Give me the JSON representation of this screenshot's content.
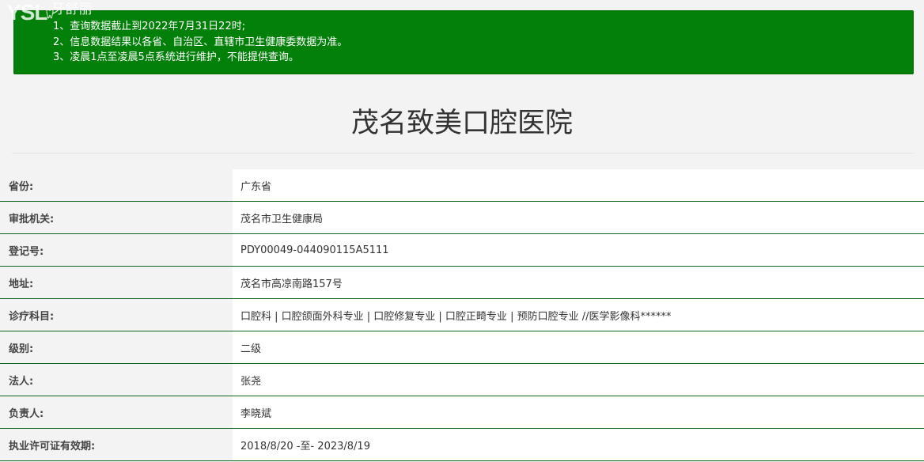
{
  "logo": {
    "mark": "YSL",
    "text": "牙舒丽"
  },
  "notice": {
    "lines": [
      "1、查询数据截止到2022年7月31日22时;",
      "2、信息数据结果以各省、自治区、直辖市卫生健康委数据为准。",
      "3、凌晨1点至凌晨5点系统进行维护，不能提供查询。"
    ]
  },
  "title": "茂名致美口腔医院",
  "rows": [
    {
      "label": "省份:",
      "value": "广东省"
    },
    {
      "label": "审批机关:",
      "value": "茂名市卫生健康局"
    },
    {
      "label": "登记号:",
      "value": "PDY00049-044090115A5111"
    },
    {
      "label": "地址:",
      "value": "茂名市高凉南路157号"
    },
    {
      "label": "诊疗科目:",
      "value": "口腔科 | 口腔颌面外科专业 | 口腔修复专业 | 口腔正畸专业 | 预防口腔专业 //医学影像科******"
    },
    {
      "label": "级别:",
      "value": "二级"
    },
    {
      "label": "法人:",
      "value": "张尧"
    },
    {
      "label": "负责人:",
      "value": "李晓斌"
    },
    {
      "label": "执业许可证有效期:",
      "value": "2018/8/20 -至- 2023/8/19"
    }
  ],
  "colors": {
    "notice_bg": "#03800a",
    "row_rule": "#10631c",
    "page_bg": "#f3f3f3"
  }
}
